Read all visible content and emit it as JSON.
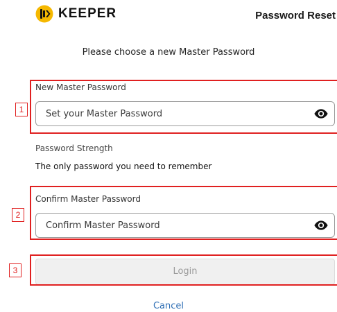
{
  "header": {
    "brand": "KEEPER",
    "title": "Password Reset"
  },
  "subtitle": "Please choose a new Master Password",
  "new_password": {
    "label": "New Master Password",
    "placeholder": "Set your Master Password",
    "value": ""
  },
  "strength": {
    "label": "Password Strength",
    "hint": "The only password you need to remember"
  },
  "confirm_password": {
    "label": "Confirm Master Password",
    "placeholder": "Confirm Master Password",
    "value": ""
  },
  "login_label": "Login",
  "cancel_label": "Cancel",
  "annotations": [
    "1",
    "2",
    "3"
  ],
  "colors": {
    "annotation": "#e02020",
    "link": "#2f6fb5",
    "button_disabled_bg": "#f0f0f0",
    "button_disabled_text": "#9a9a9a",
    "logo_accent": "#f5b800"
  },
  "icons": {
    "logo": "keeper-logo-icon",
    "show_password": "eye-icon"
  }
}
